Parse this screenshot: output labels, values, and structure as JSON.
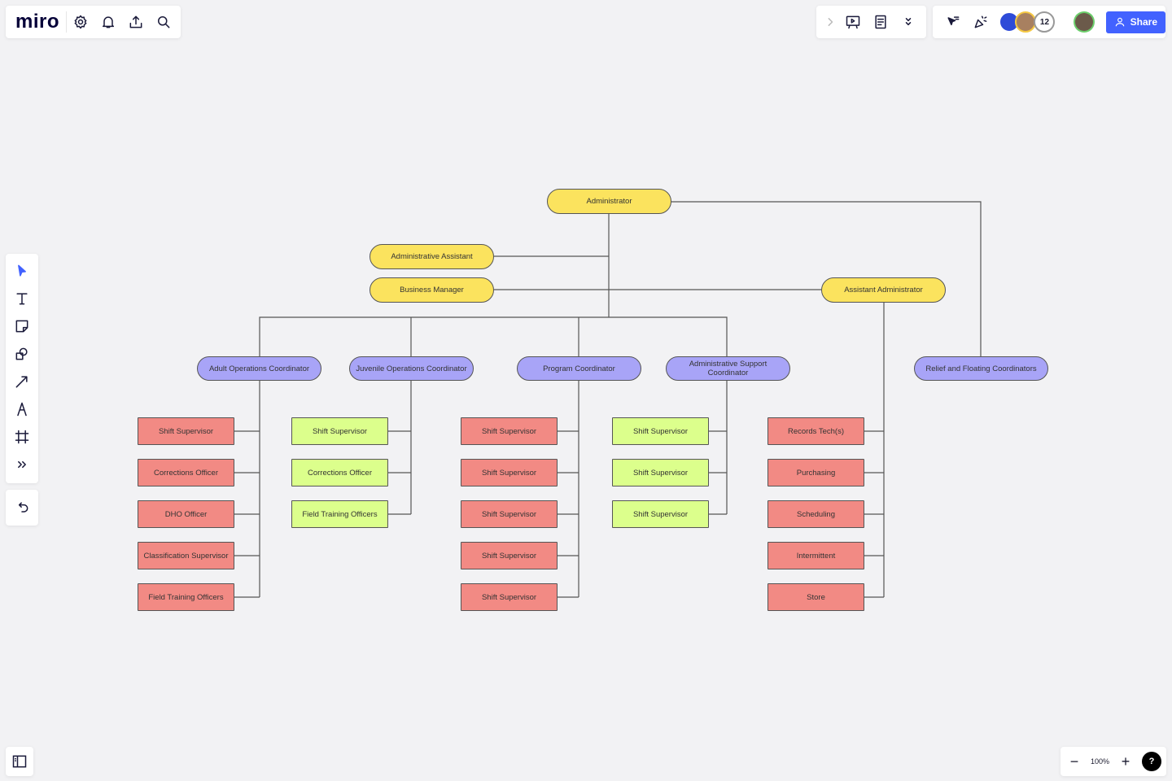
{
  "app": {
    "logo": "miro"
  },
  "topbar": {
    "share_label": "Share",
    "collaborator_count": "12",
    "icons": [
      "settings-icon",
      "bell-icon",
      "upload-icon",
      "search-icon",
      "chevron-right-icon",
      "presentation-icon",
      "notes-icon",
      "chevrons-down-icon",
      "cursor-reactions-icon",
      "celebrate-icon"
    ]
  },
  "left_toolbar": {
    "tools": [
      "select-icon",
      "text-icon",
      "sticky-note-icon",
      "shapes-icon",
      "line-icon",
      "pen-icon",
      "frame-icon",
      "more-icon"
    ],
    "undo": "undo-icon"
  },
  "zoom": {
    "level": "100%",
    "help": "?"
  },
  "colors": {
    "yellow": "#fbe35e",
    "purple": "#a8a4f7",
    "red": "#f28a84",
    "green": "#dcff8c",
    "accent": "#4262ff",
    "line": "#555555"
  },
  "chart": {
    "top": [
      {
        "label": "Administrator"
      },
      {
        "label": "Administrative Assistant"
      },
      {
        "label": "Business Manager"
      },
      {
        "label": "Assistant Administrator"
      }
    ],
    "coordinators": [
      {
        "label": "Adult Operations Coordinator"
      },
      {
        "label": "Juvenile Operations Coordinator"
      },
      {
        "label": "Program Coordinator"
      },
      {
        "label": "Administrative Support Coordinator"
      },
      {
        "label": "Relief and Floating Coordinators"
      }
    ],
    "columns": [
      {
        "color": "red",
        "items": [
          "Shift Supervisor",
          "Corrections Officer",
          "DHO Officer",
          "Classification Supervisor",
          "Field Training Officers"
        ]
      },
      {
        "color": "green",
        "items": [
          "Shift Supervisor",
          "Corrections Officer",
          "Field Training Officers"
        ]
      },
      {
        "color": "red",
        "items": [
          "Shift Supervisor",
          "Shift Supervisor",
          "Shift Supervisor",
          "Shift Supervisor",
          "Shift Supervisor"
        ]
      },
      {
        "color": "green",
        "items": [
          "Shift Supervisor",
          "Shift Supervisor",
          "Shift Supervisor"
        ]
      },
      {
        "color": "red",
        "items": [
          "Records Tech(s)",
          "Purchasing",
          "Scheduling",
          "Intermittent",
          "Store"
        ]
      }
    ]
  }
}
